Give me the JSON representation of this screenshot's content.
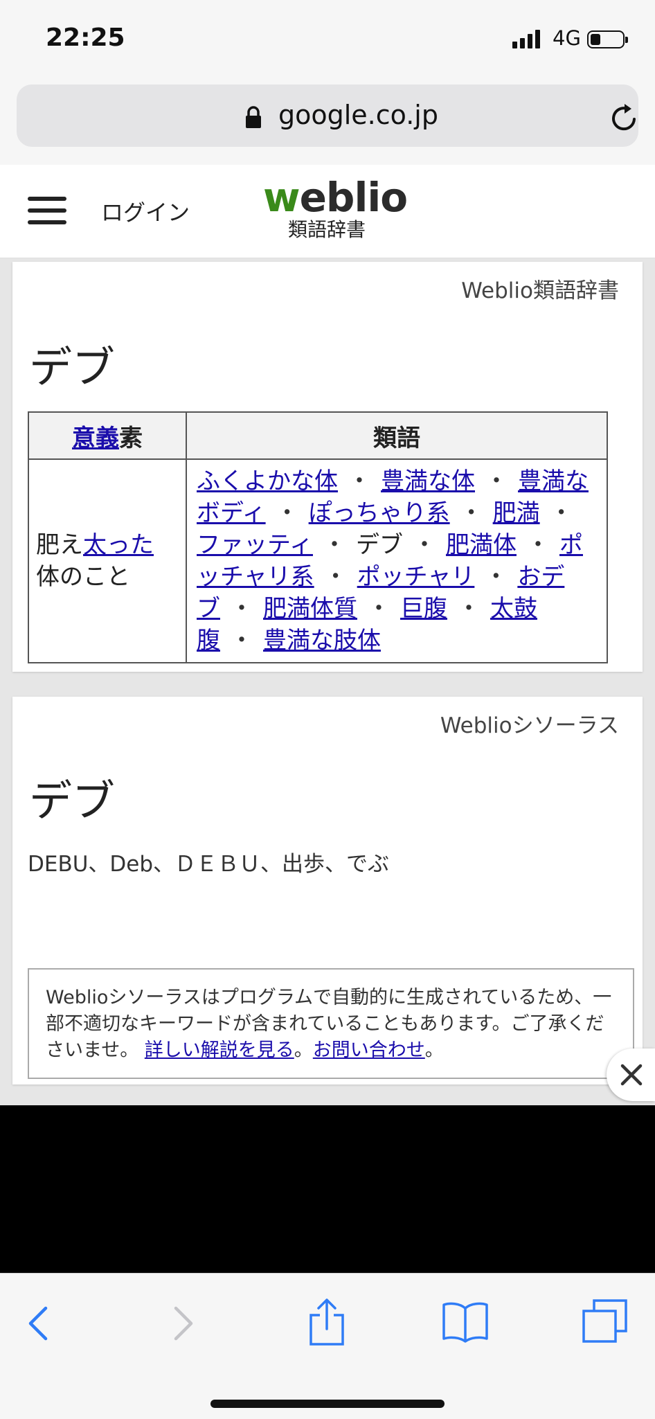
{
  "status": {
    "time": "22:25",
    "network": "4G"
  },
  "browser": {
    "url": "google.co.jp"
  },
  "site": {
    "login": "ログイン",
    "logo_w": "w",
    "logo_rest": "eblio",
    "logo_sub": "類語辞書"
  },
  "thesaurus": {
    "source": "Weblio類語辞書",
    "word": "デブ",
    "col1_header_link": "意義",
    "col1_header_rest": "素",
    "col2_header": "類語",
    "meaning_pre": "肥え",
    "meaning_link": "太った",
    "meaning_post": "体のこと",
    "synonyms": [
      {
        "text": "ふくよかな体",
        "link": true
      },
      {
        "text": "豊満な体",
        "link": true
      },
      {
        "text": "豊満なボディ",
        "link": true
      },
      {
        "text": "ぽっちゃり系",
        "link": true
      },
      {
        "text": "肥満",
        "link": true
      },
      {
        "text": "ファッティ",
        "link": true
      },
      {
        "text": "デブ",
        "link": false
      },
      {
        "text": "肥満体",
        "link": true
      },
      {
        "text": "ポッチャリ系",
        "link": true
      },
      {
        "text": "ポッチャリ",
        "link": true
      },
      {
        "text": "おデブ",
        "link": true
      },
      {
        "text": "肥満体質",
        "link": true
      },
      {
        "text": "巨腹",
        "link": true
      },
      {
        "text": "太鼓腹",
        "link": true
      },
      {
        "text": "豊満な肢体",
        "link": true
      }
    ]
  },
  "weblio_thesaurus": {
    "source": "Weblioシソーラス",
    "word": "デブ",
    "variants": "DEBU、Deb、ＤＥＢＵ、出歩、でぶ",
    "note_text": "Weblioシソーラスはプログラムで自動的に生成されているため、一部不適切なキーワードが含まれていることもあります。ご了承くださいませ。",
    "note_link1": "詳しい解説を見る",
    "note_sep": "。",
    "note_link2": "お問い合わせ",
    "note_end": "。"
  },
  "icons": {
    "lock": "lock-icon",
    "reload": "reload-icon",
    "menu": "hamburger-icon",
    "close": "close-icon",
    "back": "back-icon",
    "forward": "forward-icon",
    "share": "share-icon",
    "bookmarks": "bookmarks-icon",
    "tabs": "tabs-icon"
  },
  "colors": {
    "link": "#1a0dab",
    "logo_green": "#3a8a1a",
    "safari_blue": "#2f7cf6"
  }
}
